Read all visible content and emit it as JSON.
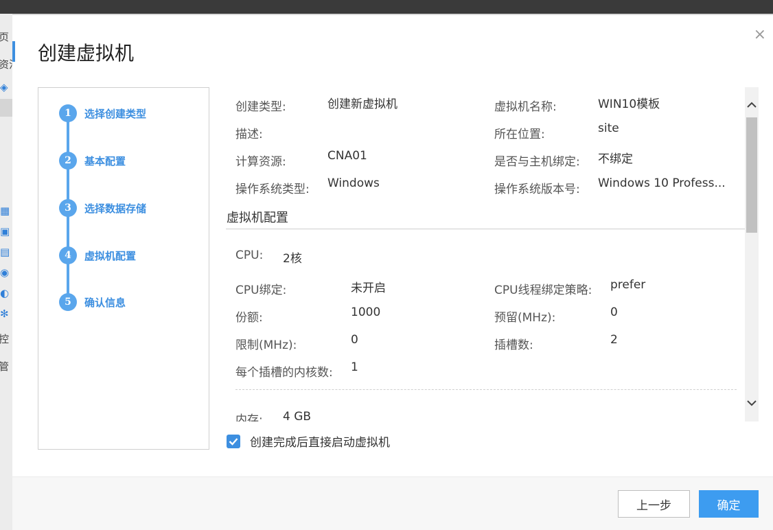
{
  "background": {
    "side_fragments": [
      "页",
      "资池",
      "管",
      "控"
    ]
  },
  "dialog": {
    "title": "创建虚拟机",
    "close_glyph": "×"
  },
  "steps": [
    {
      "num": "1",
      "label": "选择创建类型"
    },
    {
      "num": "2",
      "label": "基本配置"
    },
    {
      "num": "3",
      "label": "选择数据存储"
    },
    {
      "num": "4",
      "label": "虚拟机配置"
    },
    {
      "num": "5",
      "label": "确认信息"
    }
  ],
  "summary": {
    "create_type_label": "创建类型:",
    "create_type_value": "创建新虚拟机",
    "vm_name_label": "虚拟机名称:",
    "vm_name_value": "WIN10模板",
    "description_label": "描述:",
    "location_label": "所在位置:",
    "location_value": "site",
    "compute_label": "计算资源:",
    "compute_value": "CNA01",
    "host_bind_label": "是否与主机绑定:",
    "host_bind_value": "不绑定",
    "os_type_label": "操作系统类型:",
    "os_type_value": "Windows",
    "os_version_label": "操作系统版本号:",
    "os_version_value": "Windows 10 Profess..."
  },
  "vm_config": {
    "section_title": "虚拟机配置",
    "cpu_label": "CPU:",
    "cpu_value": "2核",
    "cpu_bind_label": "CPU绑定:",
    "cpu_bind_value": "未开启",
    "cpu_thread_policy_label": "CPU线程绑定策略:",
    "cpu_thread_policy_value": "prefer",
    "share_label": "份额:",
    "share_value": "1000",
    "reserve_label": "预留(MHz):",
    "reserve_value": "0",
    "limit_label": "限制(MHz):",
    "limit_value": "0",
    "slots_label": "插槽数:",
    "slots_value": "2",
    "cores_per_slot_label": "每个插槽的内核数:",
    "cores_per_slot_value": "1",
    "memory_label": "内存:",
    "memory_value": "4 GB"
  },
  "checkbox": {
    "label": "创建完成后直接启动虚拟机",
    "checked": true
  },
  "footer": {
    "prev_label": "上一步",
    "ok_label": "确定"
  },
  "colors": {
    "accent": "#3d8fe0",
    "step": "#5aa6ec",
    "ok_button": "#3d9cf0"
  },
  "icons": {
    "close": "close-icon",
    "scroll_up": "chevron-up-icon",
    "scroll_down": "chevron-down-icon",
    "check": "checkmark-icon"
  }
}
